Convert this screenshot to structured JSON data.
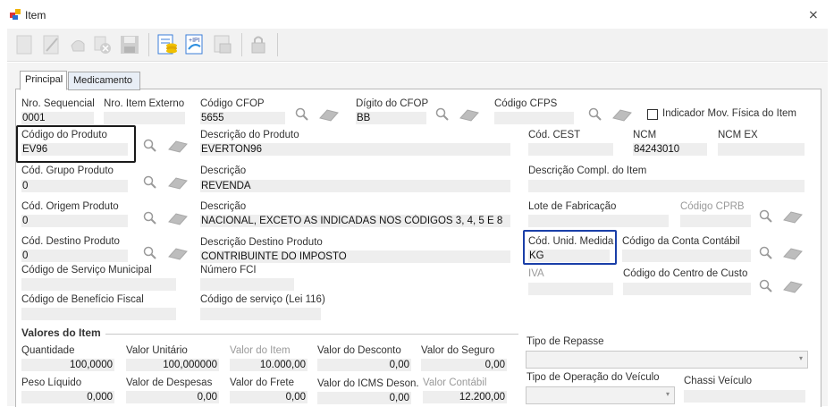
{
  "window": {
    "title": "Item",
    "close_glyph": "⨯"
  },
  "tabs": [
    {
      "label": "Principal"
    },
    {
      "label": "Medicamento"
    }
  ],
  "fields": {
    "nro_sequencial": {
      "label": "Nro. Sequencial",
      "value": "0001"
    },
    "nro_item_externo": {
      "label": "Nro. Item Externo",
      "value": ""
    },
    "codigo_cfop": {
      "label": "Código CFOP",
      "value": "5655"
    },
    "digito_cfop": {
      "label": "Dígito do CFOP",
      "value": "BB"
    },
    "codigo_cfps": {
      "label": "Código CFPS",
      "value": ""
    },
    "indicador_mov": {
      "label": "Indicador Mov. Física do Item"
    },
    "codigo_produto": {
      "label": "Código do Produto",
      "value": "EV96"
    },
    "descricao_produto": {
      "label": "Descrição do Produto",
      "value": "EVERTON96"
    },
    "cod_cest": {
      "label": "Cód. CEST",
      "value": ""
    },
    "ncm": {
      "label": "NCM",
      "value": "84243010"
    },
    "ncm_ex": {
      "label": "NCM EX",
      "value": ""
    },
    "cod_grupo_produto": {
      "label": "Cód. Grupo Produto",
      "value": "0"
    },
    "descricao_grupo": {
      "label": "Descrição",
      "value": "REVENDA"
    },
    "descricao_compl": {
      "label": "Descrição Compl. do Item",
      "value": ""
    },
    "cod_origem_produto": {
      "label": "Cód. Origem Produto",
      "value": "0"
    },
    "descricao_origem": {
      "label": "Descrição",
      "value": "NACIONAL, EXCETO AS INDICADAS NOS CÓDIGOS 3, 4, 5 E 8"
    },
    "lote_fabricacao": {
      "label": "Lote de Fabricação",
      "value": ""
    },
    "codigo_cprb": {
      "label": "Código CPRB",
      "value": ""
    },
    "cod_destino_produto": {
      "label": "Cód. Destino Produto",
      "value": "0"
    },
    "descricao_destino": {
      "label": "Descrição Destino Produto",
      "value": "CONTRIBUINTE DO IMPOSTO"
    },
    "cod_unid_medida": {
      "label": "Cód. Unid. Medida",
      "value": "KG"
    },
    "codigo_conta_contabil": {
      "label": "Código da Conta Contábil",
      "value": ""
    },
    "codigo_servico_municipal": {
      "label": "Código de Serviço Municipal",
      "value": ""
    },
    "numero_fci": {
      "label": "Número FCI",
      "value": ""
    },
    "iva": {
      "label": "IVA",
      "value": ""
    },
    "codigo_centro_custo": {
      "label": "Código do Centro de Custo",
      "value": ""
    },
    "codigo_beneficio_fiscal": {
      "label": "Código de Benefício Fiscal",
      "value": ""
    },
    "codigo_servico_lei116": {
      "label": "Código de serviço (Lei 116)",
      "value": ""
    }
  },
  "valores": {
    "section_title": "Valores do Item",
    "quantidade": {
      "label": "Quantidade",
      "value": "100,0000"
    },
    "valor_unitario": {
      "label": "Valor Unitário",
      "value": "100,000000"
    },
    "valor_item": {
      "label": "Valor do Item",
      "value": "10.000,00"
    },
    "valor_desconto": {
      "label": "Valor do Desconto",
      "value": "0,00"
    },
    "valor_seguro": {
      "label": "Valor do Seguro",
      "value": "0,00"
    },
    "peso_liquido": {
      "label": "Peso Líquido",
      "value": "0,000"
    },
    "valor_despesas": {
      "label": "Valor de Despesas",
      "value": "0,00"
    },
    "valor_frete": {
      "label": "Valor do  Frete",
      "value": "0,00"
    },
    "valor_icms_deson": {
      "label": "Valor do ICMS Deson.",
      "value": "0,00"
    },
    "valor_contabil": {
      "label": "Valor Contábil",
      "value": "12.200,00"
    }
  },
  "repasse": {
    "tipo_repasse": {
      "label": "Tipo de Repasse",
      "value": ""
    },
    "tipo_operacao_veiculo": {
      "label": "Tipo de Operação do Veículo",
      "value": ""
    },
    "chassi_veiculo": {
      "label": "Chassi Veículo",
      "value": ""
    }
  },
  "icons": {
    "search": "search-icon",
    "eraser": "eraser-icon",
    "dropdown": "▾"
  },
  "colors": {
    "highlight_dark": "#1a1a1a",
    "highlight_blue": "#1a3fa8",
    "field_bg": "#eeeeee"
  }
}
